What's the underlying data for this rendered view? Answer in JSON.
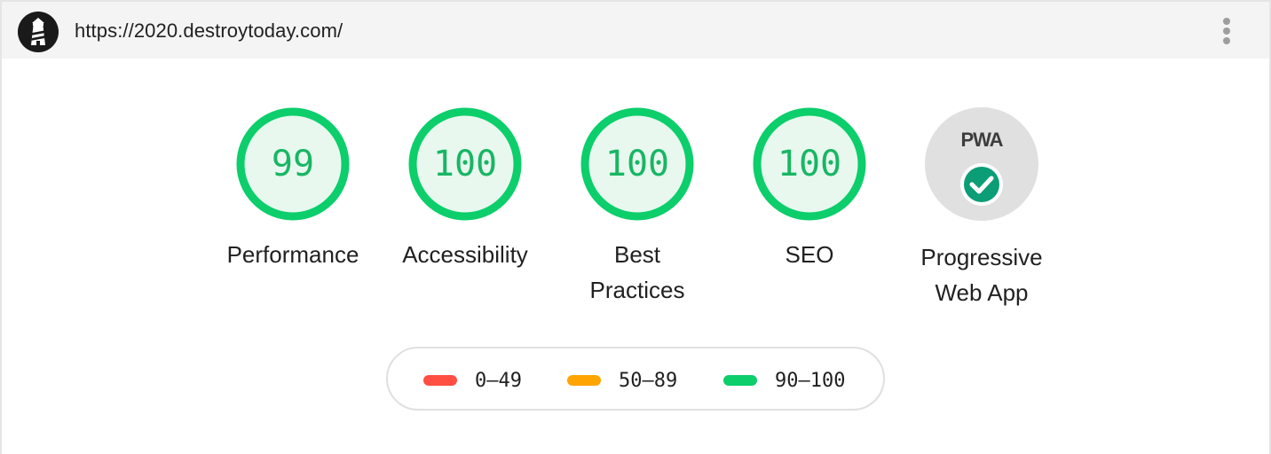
{
  "header": {
    "url": "https://2020.destroytoday.com/",
    "logo_icon": "lighthouse-icon",
    "menu_icon": "more-vert-icon"
  },
  "categories": [
    {
      "label": "Performance",
      "score": "99",
      "value": 0.99
    },
    {
      "label": "Accessibility",
      "score": "100",
      "value": 1.0
    },
    {
      "label": "Best Practices",
      "score": "100",
      "value": 1.0
    },
    {
      "label": "SEO",
      "score": "100",
      "value": 1.0
    }
  ],
  "pwa": {
    "label": "Progressive Web App",
    "badge_text": "PWA",
    "status_icon": "check-circle-icon"
  },
  "legend": [
    {
      "range": "0–49",
      "color": "#ff4e42"
    },
    {
      "range": "50–89",
      "color": "#ffa400"
    },
    {
      "range": "90–100",
      "color": "#0cce6b"
    }
  ],
  "colors": {
    "pass_ring": "#0cce6b",
    "pass_fill": "#e8f8ef",
    "pass_text": "#18b663",
    "pwa_bg": "#e0e0e0",
    "check_bg": "#0b9d76"
  }
}
